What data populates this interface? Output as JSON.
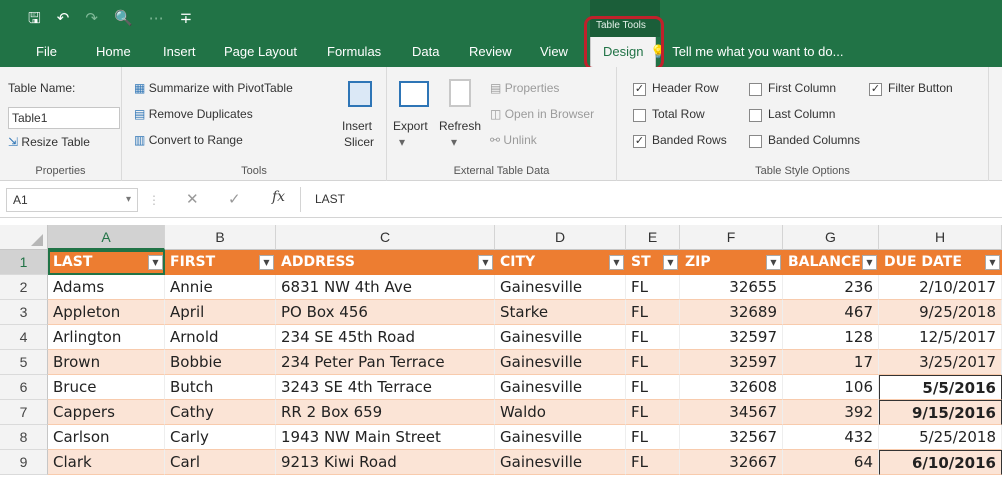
{
  "qat": {
    "save": "🖫",
    "undo": "↶",
    "redo": "↷",
    "preview": "🔍",
    "more": "⋯",
    "customize": "∓"
  },
  "context_tab_group": "Table Tools",
  "tabs": [
    "File",
    "Home",
    "Insert",
    "Page Layout",
    "Formulas",
    "Data",
    "Review",
    "View",
    "Design"
  ],
  "active_tab": "Design",
  "tell_me": "Tell me what you want to do...",
  "ribbon": {
    "properties": {
      "table_name_label": "Table Name:",
      "table_name_value": "Table1",
      "resize": "Resize Table",
      "label": "Properties"
    },
    "tools": {
      "summarize": "Summarize with PivotTable",
      "remove_dupes": "Remove Duplicates",
      "convert": "Convert to Range",
      "insert_slicer_1": "Insert",
      "insert_slicer_2": "Slicer",
      "label": "Tools"
    },
    "external": {
      "export": "Export",
      "refresh": "Refresh",
      "properties": "Properties",
      "open_browser": "Open in Browser",
      "unlink": "Unlink",
      "label": "External Table Data"
    },
    "style_options": {
      "header_row": "Header Row",
      "total_row": "Total Row",
      "banded_rows": "Banded Rows",
      "first_column": "First Column",
      "last_column": "Last Column",
      "banded_columns": "Banded Columns",
      "filter_button": "Filter Button",
      "label": "Table Style Options"
    }
  },
  "formula_bar": {
    "cell_ref": "A1",
    "cancel": "✕",
    "enter": "✓",
    "fx": "fx",
    "content": "LAST"
  },
  "columns": [
    "A",
    "B",
    "C",
    "D",
    "E",
    "F",
    "G",
    "H"
  ],
  "headers": [
    "LAST",
    "FIRST",
    "ADDRESS",
    "CITY",
    "ST",
    "ZIP",
    "BALANCE",
    "DUE DATE"
  ],
  "rows": [
    {
      "n": "2",
      "cells": [
        "Adams",
        "Annie",
        "6831 NW 4th Ave",
        "Gainesville",
        "FL",
        "32655",
        "236",
        "2/10/2017"
      ]
    },
    {
      "n": "3",
      "cells": [
        "Appleton",
        "April",
        "PO Box 456",
        "Starke",
        "FL",
        "32689",
        "467",
        "9/25/2018"
      ]
    },
    {
      "n": "4",
      "cells": [
        "Arlington",
        "Arnold",
        "234 SE 45th Road",
        "Gainesville",
        "FL",
        "32597",
        "128",
        "12/5/2017"
      ]
    },
    {
      "n": "5",
      "cells": [
        "Brown",
        "Bobbie",
        "234 Peter Pan Terrace",
        "Gainesville",
        "FL",
        "32597",
        "17",
        "3/25/2017"
      ]
    },
    {
      "n": "6",
      "cells": [
        "Bruce",
        "Butch",
        "3243 SE 4th Terrace",
        "Gainesville",
        "FL",
        "32608",
        "106",
        "5/5/2016"
      ]
    },
    {
      "n": "7",
      "cells": [
        "Cappers",
        "Cathy",
        "RR 2 Box 659",
        "Waldo",
        "FL",
        "34567",
        "392",
        "9/15/2016"
      ]
    },
    {
      "n": "8",
      "cells": [
        "Carlson",
        "Carly",
        "1943 NW Main Street",
        "Gainesville",
        "FL",
        "32567",
        "432",
        "5/25/2018"
      ]
    },
    {
      "n": "9",
      "cells": [
        "Clark",
        "Carl",
        "9213 Kiwi Road",
        "Gainesville",
        "FL",
        "32667",
        "64",
        "6/10/2016"
      ]
    }
  ],
  "header_row_num": "1",
  "colors": {
    "accent": "#217346",
    "table_header": "#ed7d31",
    "band": "#fbe4d6",
    "highlight": "#c0212b"
  }
}
